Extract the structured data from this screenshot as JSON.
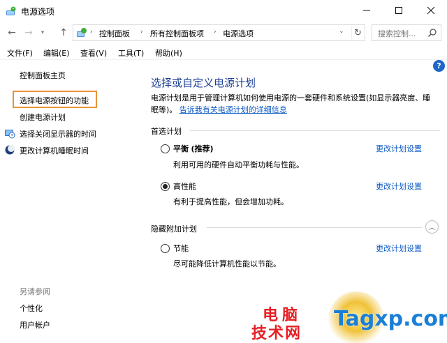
{
  "window": {
    "title": "电源选项",
    "icons": {
      "app": "power-options-icon",
      "minimize": "minimize-icon",
      "maximize": "maximize-icon",
      "close": "close-icon"
    }
  },
  "address": {
    "breadcrumb": [
      "控制面板",
      "所有控制面板项",
      "电源选项"
    ],
    "search_placeholder": "搜索控制..."
  },
  "menu": [
    "文件(F)",
    "编辑(E)",
    "查看(V)",
    "工具(T)",
    "帮助(H)"
  ],
  "sidebar": {
    "home": "控制面板主页",
    "links": [
      "选择电源按钮的功能",
      "创建电源计划",
      "选择关闭显示器的时间",
      "更改计算机睡眠时间"
    ],
    "see_also_title": "另请参阅",
    "see_also": [
      "个性化",
      "用户帐户"
    ]
  },
  "main": {
    "title": "选择或自定义电源计划",
    "description": "电源计划是用于管理计算机如何使用电源的一套硬件和系统设置(如显示器亮度、睡眠等)。",
    "description_link": "告诉我有关电源计划的详细信息",
    "preferred_heading": "首选计划",
    "hidden_heading": "隐藏附加计划",
    "change_link": "更改计划设置",
    "plans": [
      {
        "name": "平衡",
        "tag": "(推荐)",
        "desc": "利用可用的硬件自动平衡功耗与性能。",
        "selected": false
      },
      {
        "name": "高性能",
        "tag": "",
        "desc": "有利于提高性能，但会增加功耗。",
        "selected": true
      },
      {
        "name": "节能",
        "tag": "",
        "desc": "尽可能降低计算机性能以节能。",
        "selected": false
      }
    ]
  },
  "watermark": {
    "cn_line1": "电脑",
    "cn_line2": "技术网",
    "en": "Tagxp.com"
  },
  "colors": {
    "link": "#0b59c4",
    "title": "#1c3e94",
    "highlight": "#e8943a",
    "watermark_red": "#e52025",
    "watermark_blue": "#1a7fd6"
  }
}
